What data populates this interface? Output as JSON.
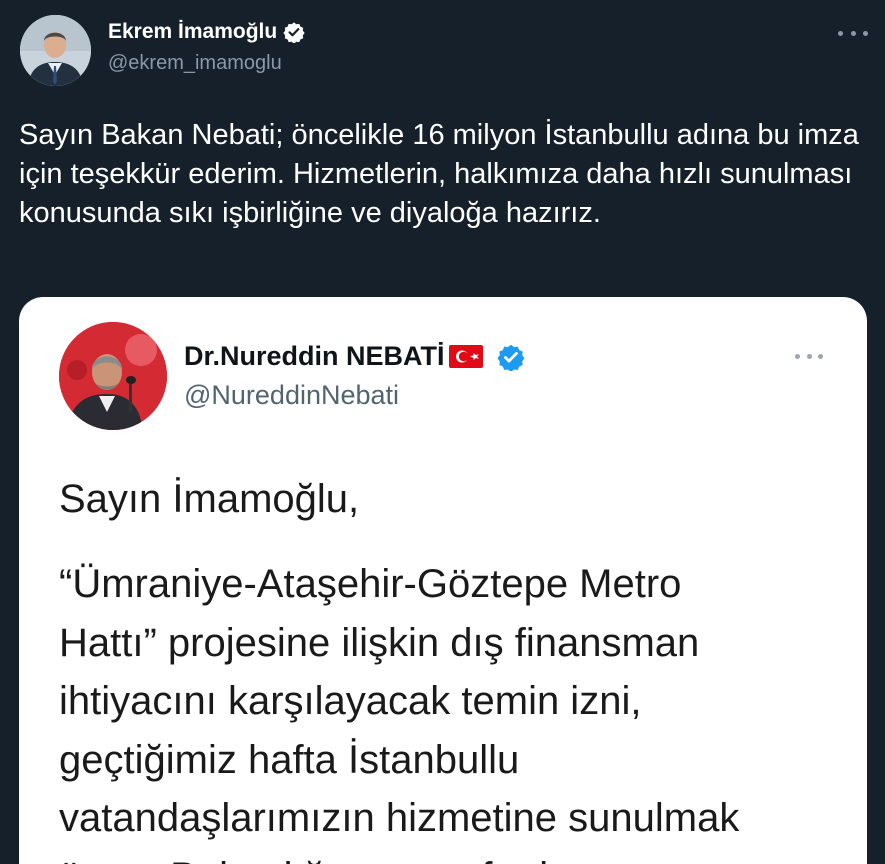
{
  "tweet": {
    "author_name": "Ekrem İmamoğlu",
    "author_handle": "@ekrem_imamoglu",
    "text": "Sayın Bakan Nebati; öncelikle 16 milyon İstanbullu adına bu imza için teşekkür ederim. Hizmetlerin, halkımıza daha hızlı sunulması konusunda sıkı işbirliğine ve diyaloğa hazırız."
  },
  "embedded_image": {
    "author_name": "Dr.Nureddin NEBATİ",
    "author_handle": "@NureddinNebati",
    "salutation": "Sayın İmamoğlu,",
    "body_lines": [
      "“Ümraniye-Ataşehir-Göztepe Metro",
      "Hattı” projesine ilişkin dış finansman",
      "ihtiyacını karşılayacak temin izni,",
      "geçtiğimiz hafta İstanbullu",
      "vatandaşlarımızın hizmetine sunulmak",
      "üzere Bakanlığımız tarafından"
    ]
  },
  "icons": {
    "verified": "verified-badge-icon",
    "more": "more-options-icon",
    "flag": "turkey-flag-icon"
  },
  "colors": {
    "background": "#15202b",
    "text_primary": "#ffffff",
    "text_secondary": "#8b98a5",
    "verified_blue": "#1d9bf0",
    "card_background": "#ffffff",
    "flag_red": "#e30a17"
  }
}
